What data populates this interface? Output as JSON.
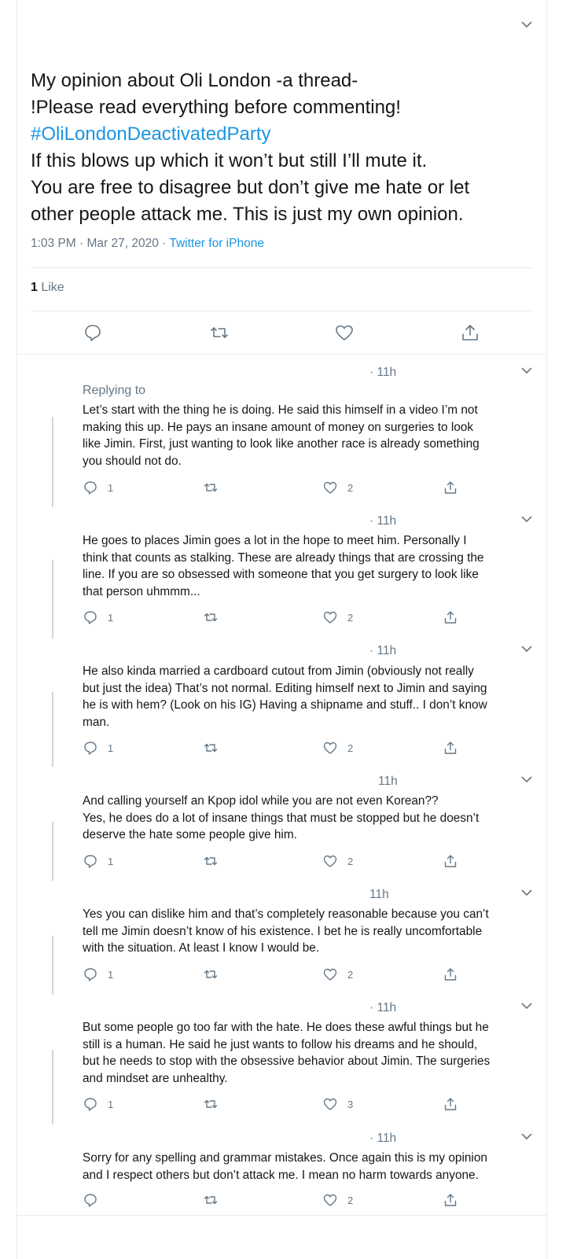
{
  "main_tweet": {
    "lines": [
      "My opinion about Oli London -a thread-",
      "!Please read everything before commenting!",
      "#OliLondonDeactivatedParty",
      "If this blows up which it won’t but still I’ll mute it.",
      "You are free to disagree but don’t give me hate or let",
      "other people attack me. This is just my own opinion."
    ],
    "timestamp": "1:03 PM · Mar 27, 2020 · ",
    "source": "Twitter for iPhone",
    "like_count": "1",
    "like_label": " Like"
  },
  "replies": [
    {
      "time": "· 11h",
      "replying_to": "Replying to",
      "lines": [
        "Let’s start with the thing he is doing. He said this himself in a video I’m not",
        "making this up. He pays an insane amount of money on surgeries to look",
        "like Jimin. First, just wanting to look like another race is already something",
        "you should not do."
      ],
      "replies": "1",
      "likes": "2"
    },
    {
      "time": "· 11h",
      "lines": [
        "He goes to places Jimin goes a lot in the hope to meet him. Personally I",
        "think that counts as stalking. These are already things that are crossing the",
        "line. If you are so obsessed with someone that you get surgery to look like",
        "that person uhmmm..."
      ],
      "replies": "1",
      "likes": "2"
    },
    {
      "time": "· 11h",
      "lines": [
        "He also kinda married a cardboard cutout from Jimin (obviously not really",
        "but just the idea) That’s not normal. Editing himself next to Jimin and saying",
        "he is with hem? (Look on his IG) Having a shipname and stuff.. I don’t know",
        "man."
      ],
      "replies": "1",
      "likes": "2"
    },
    {
      "time": "11h",
      "lines": [
        "And calling yourself an Kpop idol while you are not even Korean??",
        "Yes, he does do a lot of insane things that must be stopped but he doesn’t",
        "deserve the hate some people give him."
      ],
      "replies": "1",
      "likes": "2"
    },
    {
      "time": "11h",
      "lines": [
        "Yes you can dislike him and that’s completely reasonable because you can’t",
        "tell me Jimin doesn’t know of his existence. I bet he is really uncomfortable",
        "with the situation. At least I know I would be."
      ],
      "replies": "1",
      "likes": "2"
    },
    {
      "time": "· 11h",
      "lines": [
        "But some people go too far with the hate. He does these awful things but he",
        "still is a human. He said he just wants to follow his dreams and he should,",
        "but he needs to stop with the obsessive behavior about Jimin. The surgeries",
        "and mindset are unhealthy."
      ],
      "replies": "1",
      "likes": "3"
    },
    {
      "time": "· 11h",
      "lines": [
        "Sorry for any spelling and grammar mistakes. Once again this is my opinion",
        "and I respect others but don’t attack me. I mean no harm towards anyone."
      ],
      "replies": "",
      "likes": "2"
    }
  ],
  "colors": {
    "link": "#1b95e0",
    "muted": "#657786",
    "text": "#14171a",
    "border": "#e6ecf0"
  },
  "icons": [
    "chevron-down-icon",
    "reply-icon",
    "retweet-icon",
    "like-icon",
    "share-icon"
  ]
}
